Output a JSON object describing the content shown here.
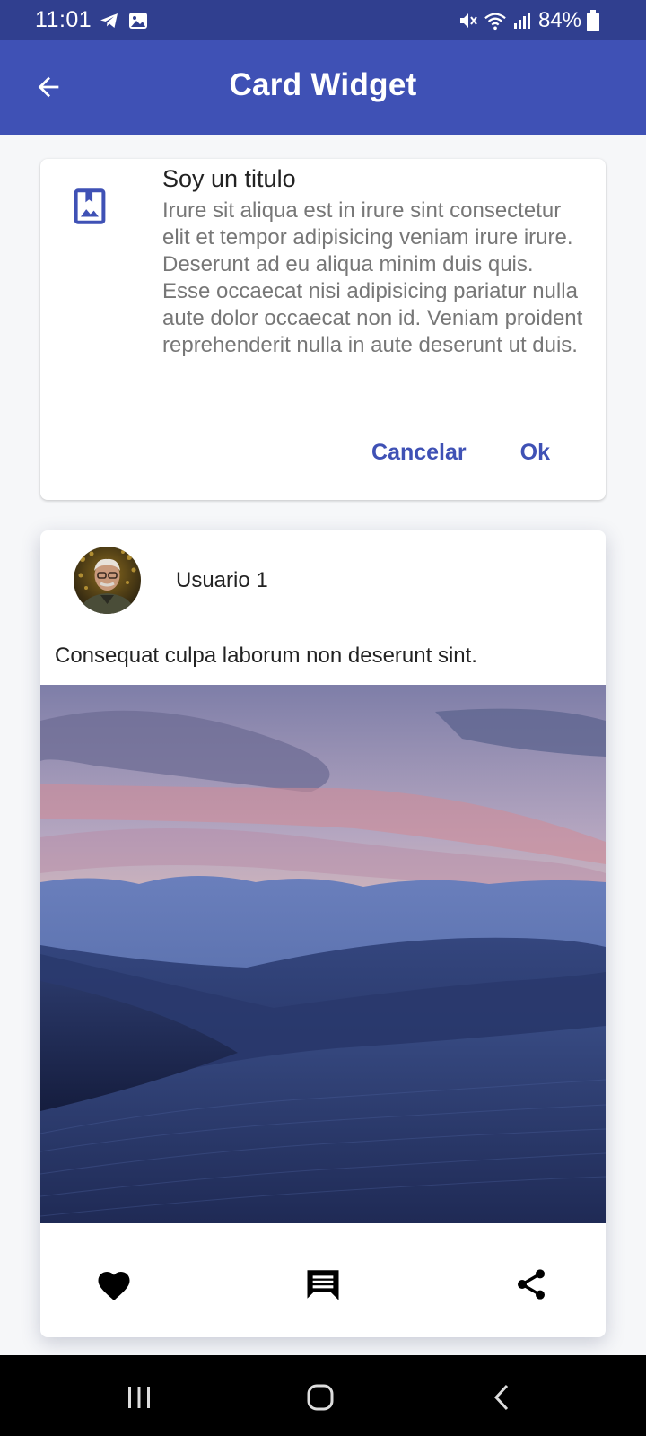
{
  "status_bar": {
    "time": "11:01",
    "battery": "84%",
    "icons": [
      "telegram-icon",
      "gallery-icon",
      "mute-icon",
      "wifi-icon",
      "signal-icon",
      "battery-icon"
    ]
  },
  "app_bar": {
    "title": "Card Widget",
    "back_icon": "arrow-back-icon",
    "color": "#3f51b5"
  },
  "info_card": {
    "icon": "photo-album-icon",
    "title": "Soy un titulo",
    "body": "Irure sit aliqua est in irure sint consectetur elit et tempor adipisicing veniam irure irure. Deserunt ad eu aliqua minim duis quis. Esse occaecat nisi adipisicing pariatur nulla aute dolor occaecat non id. Veniam proident reprehenderit nulla in aute deserunt ut duis.",
    "cancel_label": "Cancelar",
    "ok_label": "Ok"
  },
  "post_card": {
    "username": "Usuario 1",
    "text": "Consequat culpa laborum non deserunt sint.",
    "image": "desert-dunes-landscape",
    "actions": [
      "heart-icon",
      "comment-icon",
      "share-icon"
    ]
  },
  "nav_bar": {
    "buttons": [
      "recent-apps-icon",
      "home-icon",
      "back-icon"
    ]
  }
}
